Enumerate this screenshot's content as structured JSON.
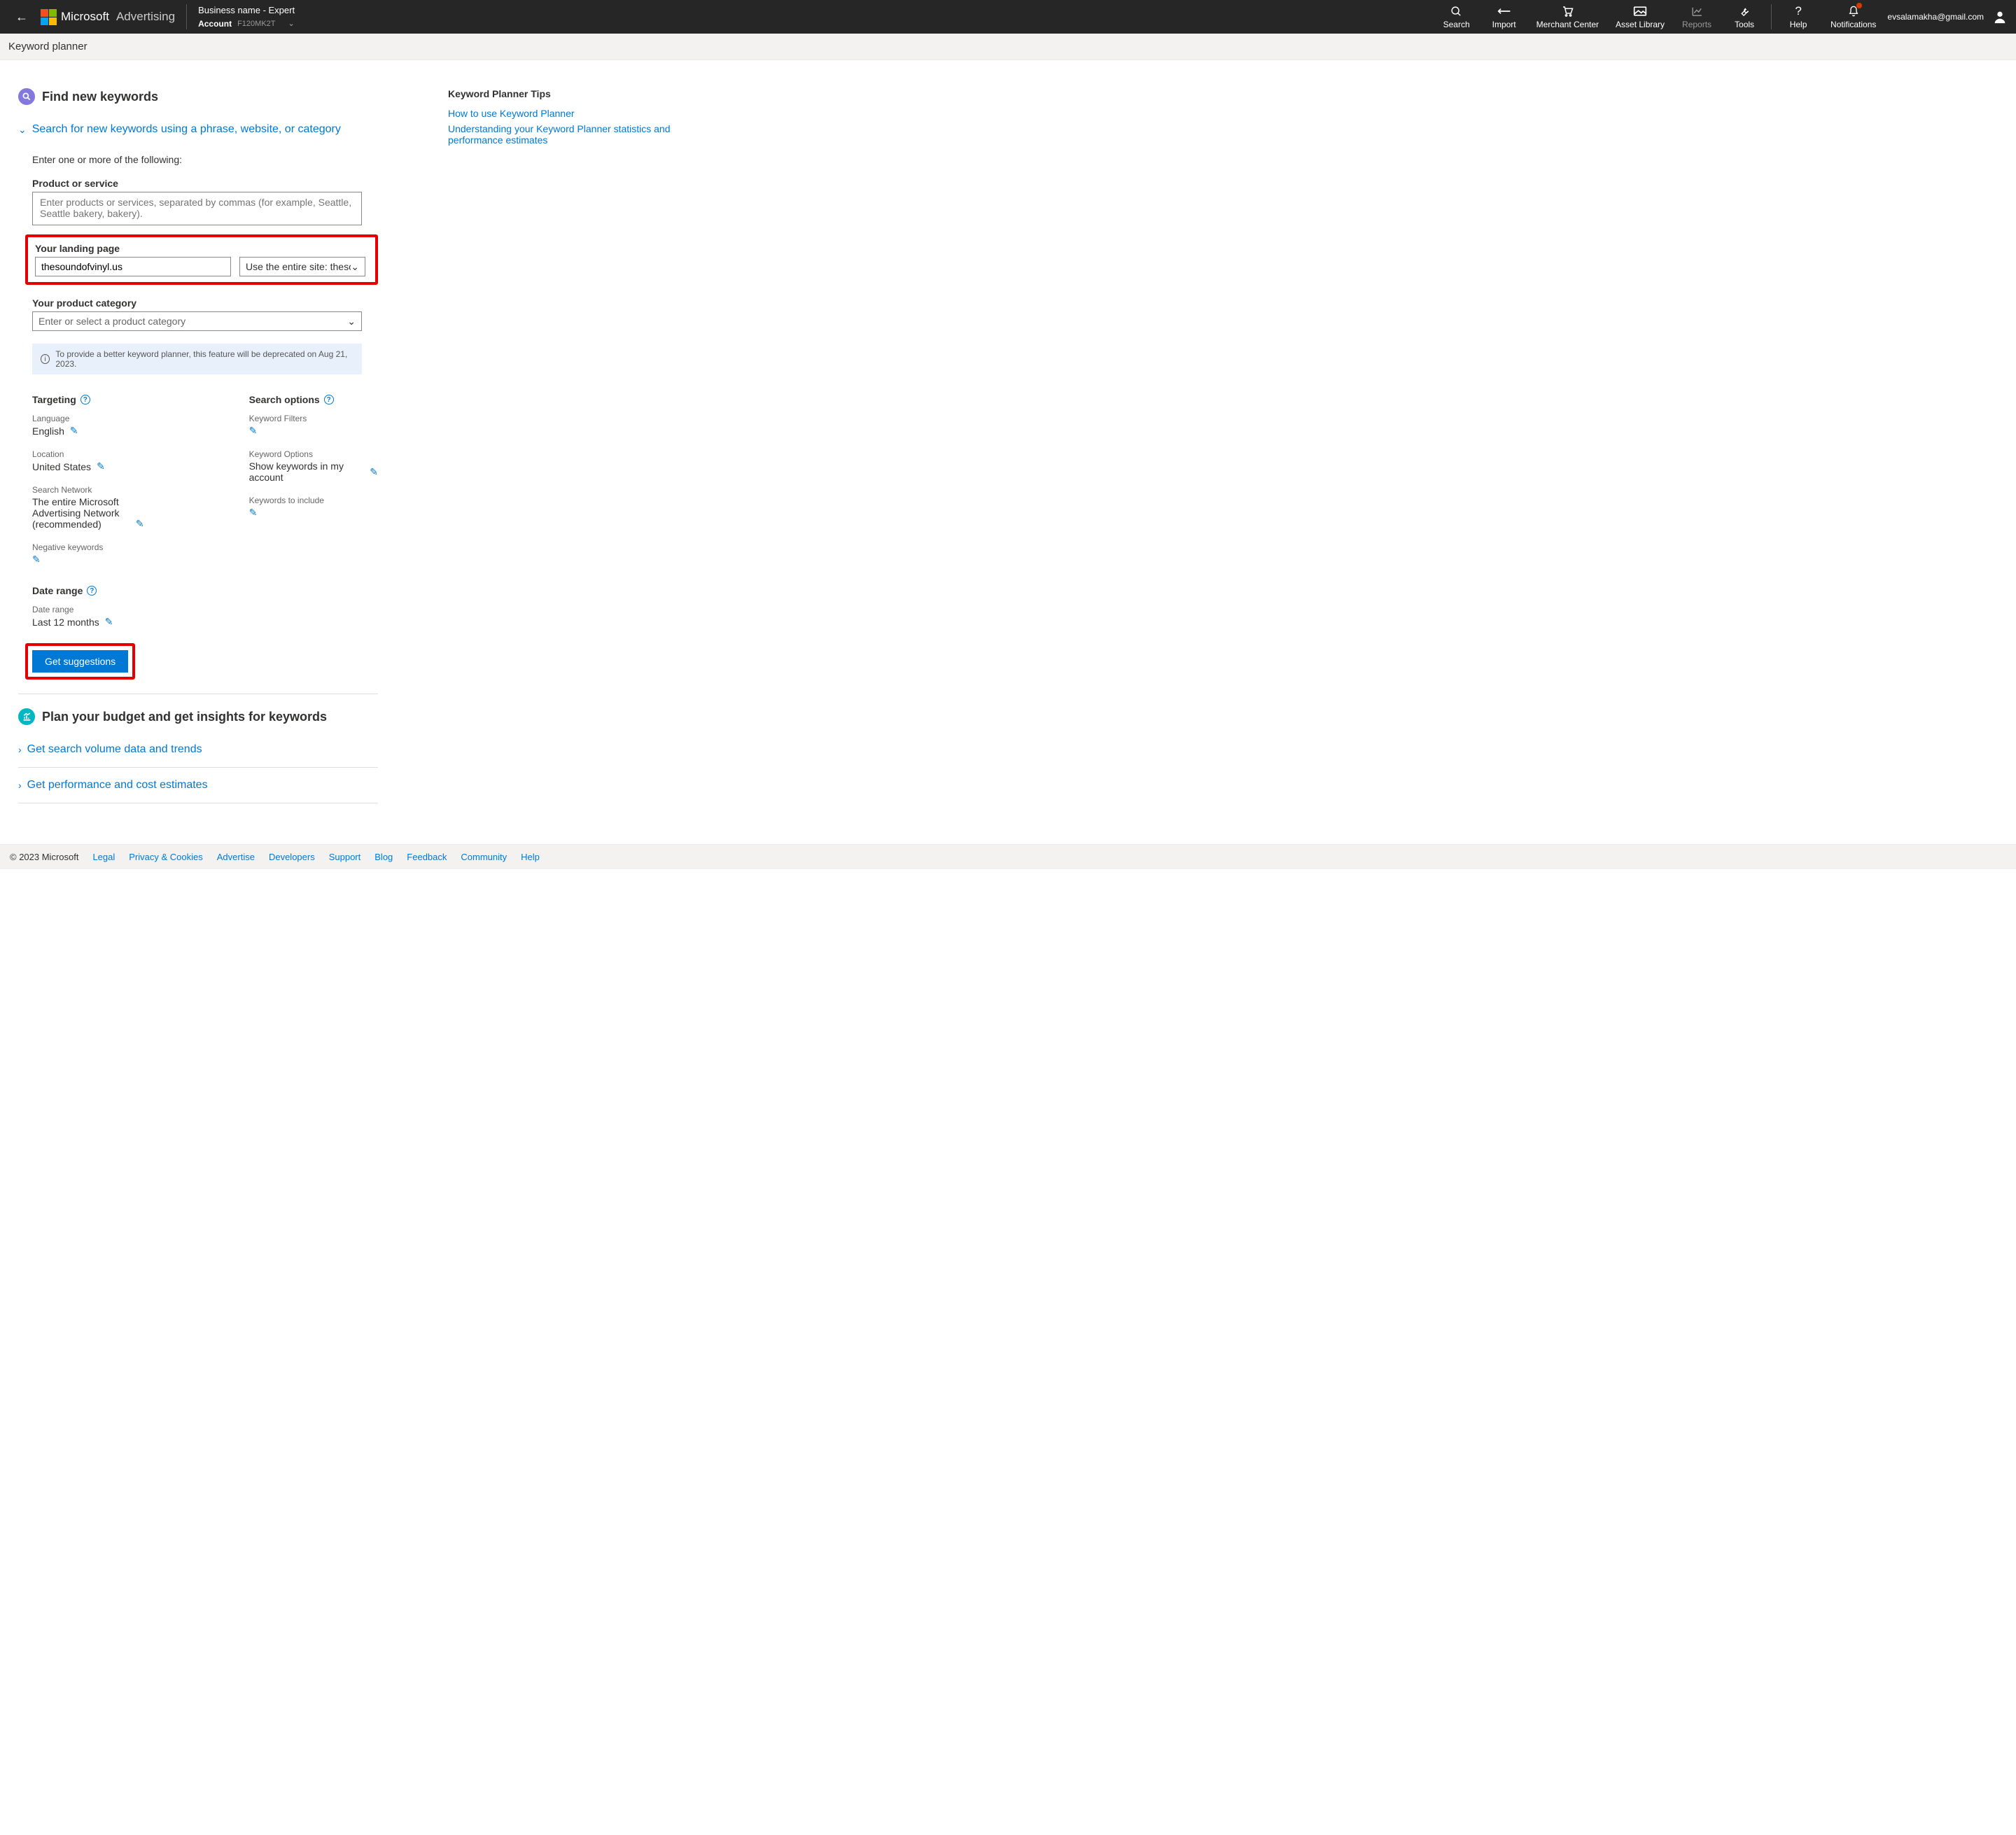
{
  "topbar": {
    "brand1": "Microsoft",
    "brand2": "Advertising",
    "business_name": "Business name - Expert",
    "account_label": "Account",
    "account_id": "F120MK2T",
    "nav": {
      "search": "Search",
      "import": "Import",
      "merchant": "Merchant Center",
      "asset": "Asset Library",
      "reports": "Reports",
      "tools": "Tools",
      "help": "Help",
      "notifications": "Notifications"
    },
    "user_email": "evsalamakha@gmail.com"
  },
  "subheader": "Keyword planner",
  "section1": {
    "title": "Find new keywords",
    "expand_label": "Search for new keywords using a phrase, website, or category",
    "intro": "Enter one or more of the following:",
    "product_label": "Product or service",
    "product_placeholder": "Enter products or services, separated by commas (for example, Seattle, Seattle bakery, bakery).",
    "landing_label": "Your landing page",
    "landing_value": "thesoundofvinyl.us",
    "landing_scope": "Use the entire site: thesoundofv",
    "category_label": "Your product category",
    "category_placeholder": "Enter or select a product category",
    "info_text": "To provide a better keyword planner, this feature will be deprecated on Aug 21, 2023."
  },
  "targeting": {
    "title": "Targeting",
    "language_label": "Language",
    "language_value": "English",
    "location_label": "Location",
    "location_value": "United States",
    "network_label": "Search Network",
    "network_value": "The entire Microsoft Advertising Network (recommended)",
    "negkw_label": "Negative keywords"
  },
  "search_options": {
    "title": "Search options",
    "filters_label": "Keyword Filters",
    "options_label": "Keyword Options",
    "options_value": "Show keywords in my account",
    "include_label": "Keywords to include"
  },
  "date_range": {
    "title": "Date range",
    "label": "Date range",
    "value": "Last 12 months"
  },
  "buttons": {
    "get_suggestions": "Get suggestions"
  },
  "section2": {
    "title": "Plan your budget and get insights for keywords",
    "link1": "Get search volume data and trends",
    "link2": "Get performance and cost estimates"
  },
  "tips": {
    "title": "Keyword Planner Tips",
    "link1": "How to use Keyword Planner",
    "link2": "Understanding your Keyword Planner statistics and performance estimates"
  },
  "footer": {
    "copyright": "© 2023 Microsoft",
    "links": [
      "Legal",
      "Privacy & Cookies",
      "Advertise",
      "Developers",
      "Support",
      "Blog",
      "Feedback",
      "Community",
      "Help"
    ]
  }
}
